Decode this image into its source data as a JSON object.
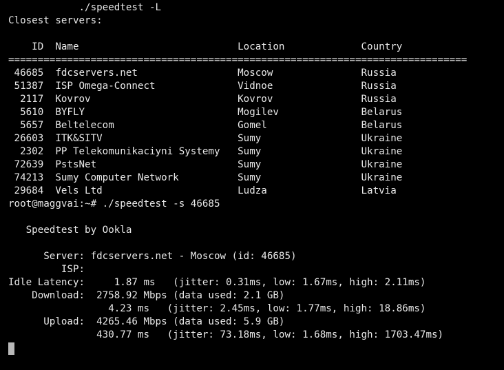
{
  "window": {
    "app": "terminal",
    "colors": {
      "background": "#000000",
      "text": "#e8e8e8",
      "cursor": "#b8b8b8"
    }
  },
  "terminal": {
    "lines": [
      "            ./speedtest -L",
      "Closest servers:",
      "",
      "    ID  Name                           Location             Country",
      "==============================================================================",
      " 46685  fdcservers.net                 Moscow               Russia",
      " 51387  ISP Omega-Connect              Vidnoe               Russia",
      "  2117  Kovrov                         Kovrov               Russia",
      "  5610  BYFLY                          Mogilev              Belarus",
      "  5657  Beltelecom                     Gomel                Belarus",
      " 26603  ITK&SITV                       Sumy                 Ukraine",
      "  2302  PP Telekomunikaciyni Systemy   Sumy                 Ukraine",
      " 72639  PstsNet                        Sumy                 Ukraine",
      " 74213  Sumy Computer Network          Sumy                 Ukraine",
      " 29684  Vels Ltd                       Ludza                Latvia",
      "root@maggvai:~# ./speedtest -s 46685",
      "",
      "   Speedtest by Ookla",
      "",
      "      Server: fdcservers.net - Moscow (id: 46685)",
      "         ISP:",
      "Idle Latency:     1.87 ms   (jitter: 0.31ms, low: 1.67ms, high: 2.11ms)",
      "    Download:  2758.92 Mbps (data used: 2.1 GB)",
      "                 4.23 ms   (jitter: 2.45ms, low: 1.77ms, high: 18.86ms)",
      "      Upload:  4265.46 Mbps (data used: 5.9 GB)",
      "               430.77 ms   (jitter: 73.18ms, low: 1.68ms, high: 1703.47ms)",
      ""
    ]
  }
}
